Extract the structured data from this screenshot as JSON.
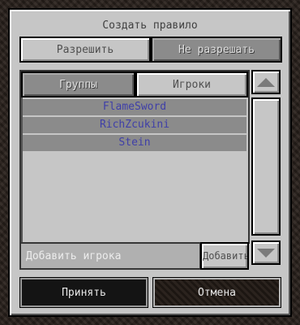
{
  "dialog": {
    "title": "Создать правило"
  },
  "mode_toggle": {
    "allow_label": "Разрешить",
    "deny_label": "Не разрешать"
  },
  "tabs": {
    "groups_label": "Группы",
    "players_label": "Игроки"
  },
  "players": [
    {
      "name": "FlameSword"
    },
    {
      "name": "RichZcukini"
    },
    {
      "name": "Stein"
    }
  ],
  "add_player": {
    "placeholder": "Добавить игрока",
    "button_label": "Добавить"
  },
  "footer": {
    "accept_label": "Принять",
    "cancel_label": "Отмена"
  },
  "colors": {
    "player_name": "#3f3fa8",
    "panel": "#c6c6c6",
    "background": "#2e2520"
  }
}
